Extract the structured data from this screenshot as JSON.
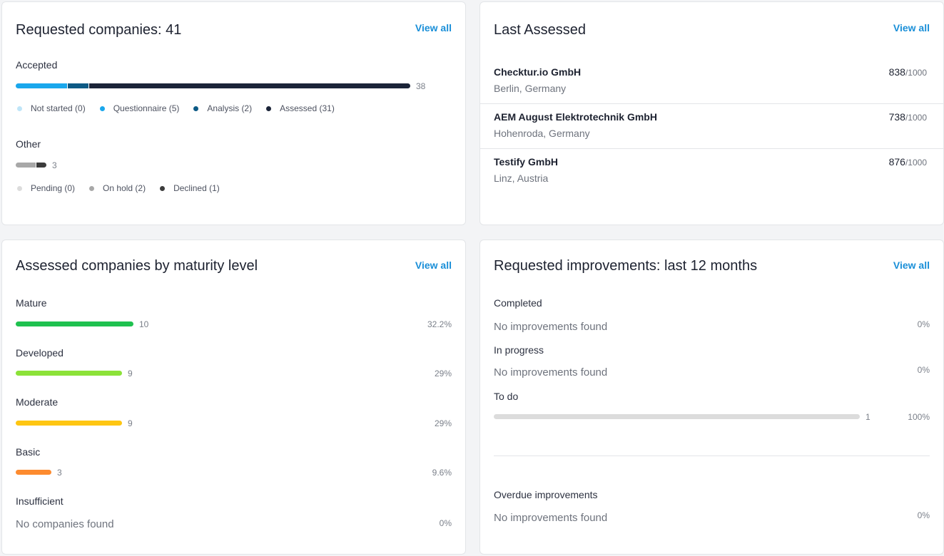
{
  "requested": {
    "title": "Requested companies: 41",
    "view_all": "View all",
    "accepted_label": "Accepted",
    "accepted_count": "38",
    "accepted_legend": [
      {
        "label": "Not started (0)",
        "color": "#bfe5f8"
      },
      {
        "label": "Questionnaire (5)",
        "color": "#1aa7ec"
      },
      {
        "label": "Analysis (2)",
        "color": "#0d5a85"
      },
      {
        "label": "Assessed (31)",
        "color": "#1b2438"
      }
    ],
    "other_label": "Other",
    "other_count": "3",
    "other_legend": [
      {
        "label": "Pending (0)",
        "color": "#dcdcdc"
      },
      {
        "label": "On hold (2)",
        "color": "#a8a8a8"
      },
      {
        "label": "Declined (1)",
        "color": "#3c3c3c"
      }
    ]
  },
  "last_assessed": {
    "title": "Last Assessed",
    "view_all": "View all",
    "companies": [
      {
        "name": "Checktur.io GmbH",
        "location": "Berlin, Germany",
        "score": "838",
        "max": "/1000"
      },
      {
        "name": "AEM August Elektrotechnik GmbH",
        "location": "Hohenroda, Germany",
        "score": "738",
        "max": "/1000"
      },
      {
        "name": "Testify GmbH",
        "location": "Linz, Austria",
        "score": "876",
        "max": "/1000"
      }
    ]
  },
  "maturity": {
    "title": "Assessed companies by maturity level",
    "view_all": "View all",
    "levels": [
      {
        "label": "Mature",
        "count": "10",
        "percent": "32.2%",
        "color": "#1fc14f"
      },
      {
        "label": "Developed",
        "count": "9",
        "percent": "29%",
        "color": "#8ce239"
      },
      {
        "label": "Moderate",
        "count": "9",
        "percent": "29%",
        "color": "#fec612"
      },
      {
        "label": "Basic",
        "count": "3",
        "percent": "9.6%",
        "color": "#fd8b2f"
      },
      {
        "label": "Insufficient",
        "empty_text": "No companies found",
        "percent": "0%"
      }
    ]
  },
  "improvements": {
    "title": "Requested improvements: last 12 months",
    "view_all": "View all",
    "completed_label": "Completed",
    "completed_empty": "No improvements found",
    "completed_percent": "0%",
    "in_progress_label": "In progress",
    "in_progress_empty": "No improvements found",
    "in_progress_percent": "0%",
    "todo_label": "To do",
    "todo_count": "1",
    "todo_percent": "100%",
    "overdue_label": "Overdue improvements",
    "overdue_empty": "No improvements found",
    "overdue_percent": "0%"
  }
}
